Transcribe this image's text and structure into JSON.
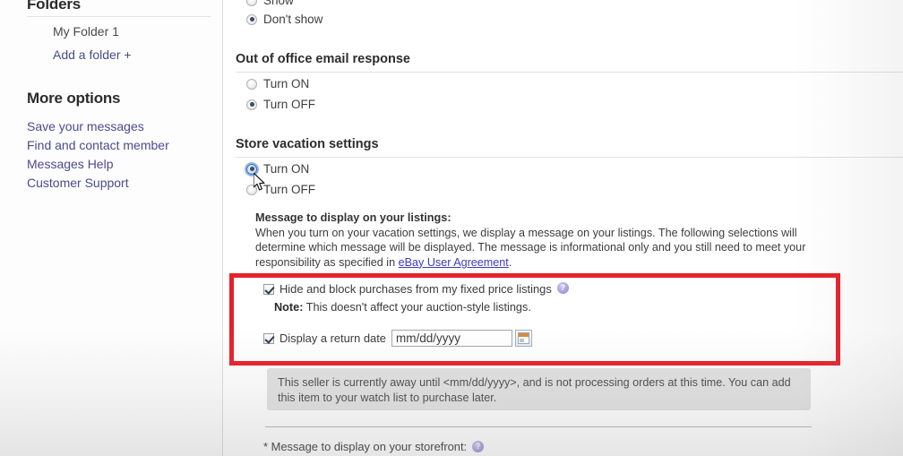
{
  "sidebar": {
    "folders_title": "Folders",
    "folder_items": [
      {
        "label": "My Folder 1"
      },
      {
        "label": "Add a folder +"
      }
    ],
    "more_options_title": "More options",
    "more_options": [
      {
        "label": "Save your messages"
      },
      {
        "label": "Find and contact member"
      },
      {
        "label": "Messages Help"
      },
      {
        "label": "Customer Support"
      }
    ]
  },
  "main": {
    "top_radio_group": {
      "options": [
        {
          "label": "Show",
          "selected": false
        },
        {
          "label": "Don't show",
          "selected": true
        }
      ]
    },
    "out_of_office": {
      "heading": "Out of office email response",
      "options": [
        {
          "label": "Turn ON",
          "selected": false
        },
        {
          "label": "Turn OFF",
          "selected": true
        }
      ]
    },
    "store_vacation": {
      "heading": "Store vacation settings",
      "options": [
        {
          "label": "Turn ON",
          "selected": true,
          "focused": true
        },
        {
          "label": "Turn OFF",
          "selected": false
        }
      ]
    },
    "message_block": {
      "title": "Message to display on your listings:",
      "body_part_1": "When you turn on your vacation settings, we display a message on your listings. The following selections will determine which message will be displayed. The message is informational only and you still need to meet your responsibility as specified in ",
      "link_text": "eBay User Agreement",
      "body_part_2": "."
    },
    "highlighted_options": {
      "hide_block": {
        "label": "Hide and block purchases from my fixed price listings",
        "checked": true,
        "help_icon": "help-icon",
        "help_glyph": "?"
      },
      "note_prefix": "Note:",
      "note_text": " This doesn't affect your auction-style listings.",
      "return_date": {
        "label": "Display a return date",
        "checked": true,
        "input_value": "",
        "input_placeholder": "mm/dd/yyyy",
        "calendar_icon": "calendar-icon"
      }
    },
    "info_box": {
      "text": "This seller is currently away until <mm/dd/yyyy>, and is not processing orders at this time. You can add this item to your watch list to purchase later."
    },
    "storefront_line": {
      "text": "* Message to display on your storefront:",
      "help_glyph": "?"
    }
  },
  "annotation": {
    "highlight_color": "#e8202a"
  }
}
